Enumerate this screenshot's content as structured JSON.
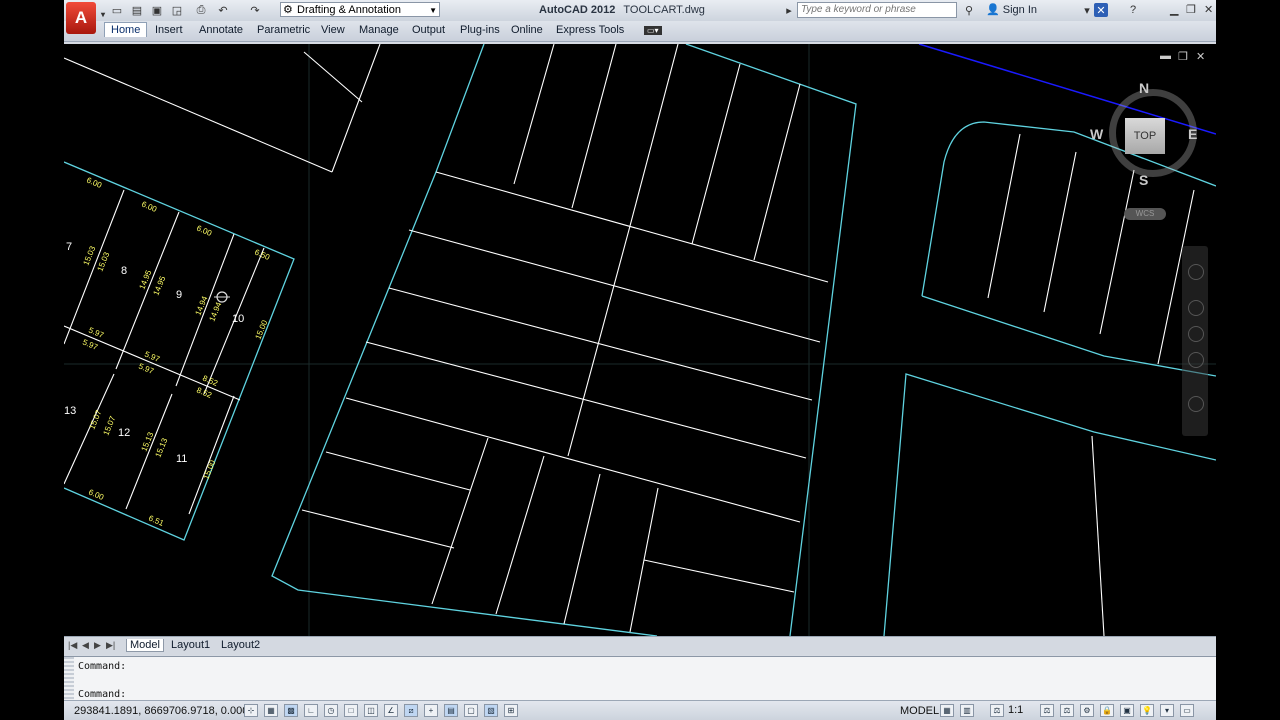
{
  "app": {
    "title": "AutoCAD 2012",
    "filename": "TOOLCART.dwg",
    "logo_letter": "A",
    "workspace": "Drafting & Annotation",
    "search_placeholder": "Type a keyword or phrase",
    "sign_in": "Sign In",
    "help": "?"
  },
  "ribbon": {
    "tabs": [
      "Home",
      "Insert",
      "Annotate",
      "Parametric",
      "View",
      "Manage",
      "Output",
      "Plug-ins",
      "Online",
      "Express Tools"
    ]
  },
  "viewcube": {
    "top_face": "TOP",
    "north": "N",
    "south": "S",
    "east": "E",
    "west": "W",
    "ucs": "WCS"
  },
  "drawing": {
    "lot_numbers": [
      "7",
      "8",
      "9",
      "10",
      "11",
      "12",
      "13"
    ],
    "dimensions": [
      "6.00",
      "6.00",
      "6.00",
      "6.50",
      "15.03",
      "15.03",
      "14.95",
      "14.95",
      "14.94",
      "14.94",
      "15.00",
      "5.97",
      "5.97",
      "5.97",
      "5.97",
      "8.52",
      "8.52",
      "15.07",
      "15.07",
      "15.13",
      "15.13",
      "15.00",
      "6.00",
      "6.51"
    ]
  },
  "layout_tabs": [
    "Model",
    "Layout1",
    "Layout2"
  ],
  "command": {
    "history": [
      "Command:"
    ],
    "prompt": "Command:"
  },
  "status": {
    "coordinates": "293841.1891, 8669706.9718, 0.0000",
    "space": "MODEL",
    "annotation_scale": "1:1"
  },
  "colors": {
    "background": "#000000",
    "boundary": "#5fd3e0",
    "lines": "#ffffff",
    "dim_text": "#ffff66",
    "axis": "#1a1aff"
  }
}
